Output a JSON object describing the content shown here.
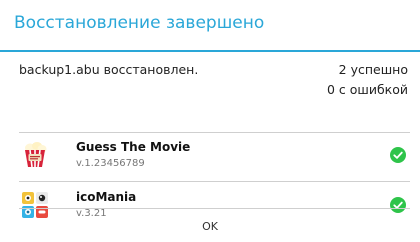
{
  "dialog": {
    "title": "Восстановление завершено",
    "summary": "backup1.abu восстановлен.",
    "success_count": "2 успешно",
    "error_count": "0 с ошибкой",
    "ok_label": "OK",
    "accent_color": "#2aa7d8",
    "success_color": "#2ec44a"
  },
  "apps": [
    {
      "name": "Guess The Movie",
      "version": "v.1.23456789",
      "icon": "popcorn-box-icon",
      "status": "check-icon"
    },
    {
      "name": "icoMania",
      "version": "v.3.21",
      "icon": "icomania-icon",
      "status": "check-icon"
    }
  ]
}
